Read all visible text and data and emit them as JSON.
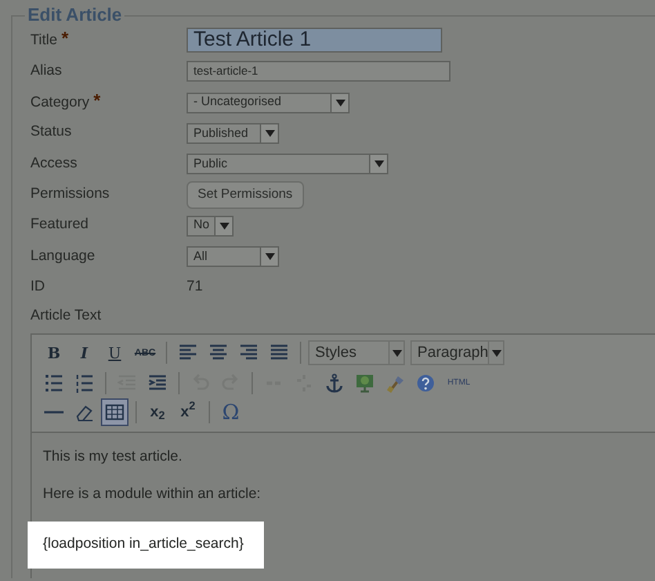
{
  "legend": "Edit Article",
  "fields": [
    {
      "label": "Title",
      "required_mark": "*",
      "kind": "title",
      "value": "Test Article 1"
    },
    {
      "label": "Alias",
      "kind": "text",
      "value": "test-article-1"
    },
    {
      "label": "Category",
      "required_mark": "*",
      "kind": "select",
      "value": "- Uncategorised"
    },
    {
      "label": "Status",
      "kind": "select",
      "value": "Published"
    },
    {
      "label": "Access",
      "kind": "select",
      "value": "Public"
    },
    {
      "label": "Permissions",
      "kind": "button",
      "value": "Set Permissions"
    },
    {
      "label": "Featured",
      "kind": "select",
      "value": "No"
    },
    {
      "label": "Language",
      "kind": "select",
      "value": "All"
    },
    {
      "label": "ID",
      "kind": "static",
      "value": "71"
    }
  ],
  "editor": {
    "label": "Article Text",
    "toolbar": [
      [
        {
          "kind": "label",
          "label": "B",
          "selected": false,
          "disabled": false
        },
        {
          "kind": "label",
          "label": "I",
          "selected": false,
          "disabled": false
        },
        {
          "kind": "label",
          "label": "U",
          "selected": false,
          "disabled": false
        },
        {
          "kind": "label",
          "label": "ABC",
          "selected": false,
          "disabled": false
        },
        {
          "kind": "sep"
        },
        {
          "kind": "icon",
          "selected": false,
          "disabled": false
        },
        {
          "kind": "icon",
          "selected": false,
          "disabled": false
        },
        {
          "kind": "icon",
          "selected": false,
          "disabled": false
        },
        {
          "kind": "icon",
          "selected": false,
          "disabled": false
        },
        {
          "kind": "sep"
        },
        {
          "kind": "select",
          "label": "Styles"
        },
        {
          "kind": "select",
          "label": "Paragraph"
        }
      ],
      [
        {
          "kind": "icon",
          "selected": false,
          "disabled": false
        },
        {
          "kind": "icon",
          "selected": false,
          "disabled": false
        },
        {
          "kind": "sep"
        },
        {
          "kind": "icon",
          "selected": false,
          "disabled": true
        },
        {
          "kind": "icon",
          "selected": false,
          "disabled": false
        },
        {
          "kind": "sep"
        },
        {
          "kind": "icon",
          "selected": false,
          "disabled": true
        },
        {
          "kind": "icon",
          "selected": false,
          "disabled": true
        },
        {
          "kind": "sep"
        },
        {
          "kind": "icon",
          "selected": false,
          "disabled": true
        },
        {
          "kind": "icon",
          "selected": false,
          "disabled": true
        },
        {
          "kind": "icon",
          "selected": false,
          "disabled": false
        },
        {
          "kind": "icon",
          "selected": false,
          "disabled": false
        },
        {
          "kind": "icon",
          "selected": false,
          "disabled": false
        },
        {
          "kind": "icon",
          "selected": false,
          "disabled": false
        },
        {
          "kind": "label",
          "label": "HTML",
          "selected": false,
          "disabled": false
        }
      ],
      [
        {
          "kind": "icon",
          "selected": false,
          "disabled": false
        },
        {
          "kind": "icon",
          "selected": false,
          "disabled": false
        },
        {
          "kind": "icon",
          "selected": true,
          "disabled": false
        },
        {
          "kind": "sep"
        },
        {
          "kind": "label",
          "label": "x$_{2}$",
          "selected": false,
          "disabled": false
        },
        {
          "kind": "label",
          "label": "x$^{2}$",
          "selected": false,
          "disabled": false
        },
        {
          "kind": "sep"
        },
        {
          "kind": "label",
          "label": "Ω",
          "selected": false,
          "disabled": false
        }
      ]
    ],
    "paragraphs": [
      {
        "text": "This is my test article.",
        "highlighted": false
      },
      {
        "text": "Here is a module within an article:",
        "highlighted": false
      },
      {
        "text": "{loadposition in_article_search}",
        "highlighted": true
      }
    ]
  }
}
